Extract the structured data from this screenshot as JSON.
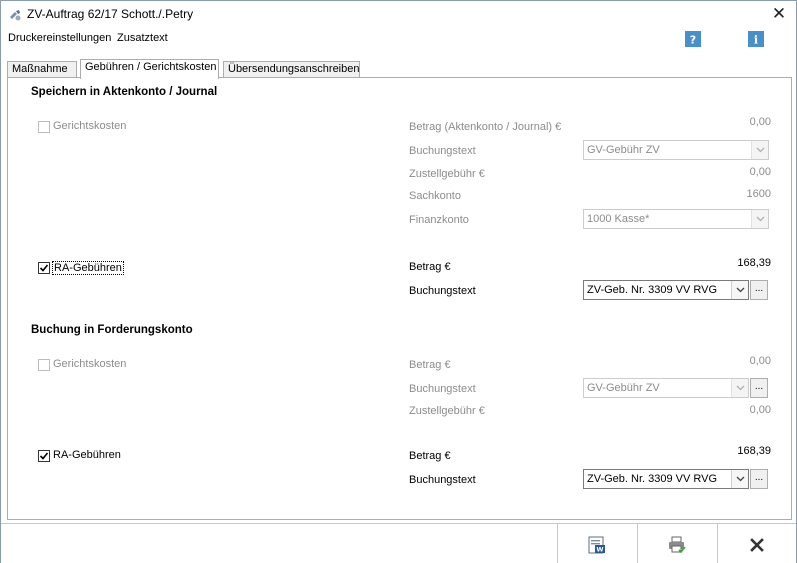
{
  "window": {
    "title": "ZV-Auftrag  62/17 Schott./.Petry",
    "close_icon": "close-icon"
  },
  "menu": {
    "items": [
      "Druckereinstellungen",
      "Zusatztext"
    ],
    "help_icon": "help-icon",
    "info_icon": "info-icon"
  },
  "tabs": [
    {
      "label": "Maßnahme",
      "active": false
    },
    {
      "label": "Gebühren / Gerichtskosten",
      "active": true
    },
    {
      "label": "Übersendungsanschreiben",
      "active": false
    }
  ],
  "section1": {
    "title": "Speichern in Aktenkonto / Journal",
    "gerichtskosten": {
      "label": "Gerichtskosten",
      "checked": false,
      "disabled": true,
      "betrag_label": "Betrag (Aktenkonto / Journal) €",
      "betrag_value": "0,00",
      "buchungstext_label": "Buchungstext",
      "buchungstext_value": "GV-Gebühr ZV",
      "zustell_label": "Zustellgebühr €",
      "zustell_value": "0,00",
      "sachkonto_label": "Sachkonto",
      "sachkonto_value": "1600",
      "finanzkonto_label": "Finanzkonto",
      "finanzkonto_value": "1000 Kasse*"
    },
    "ra_gebuehren": {
      "label": "RA-Gebühren",
      "checked": true,
      "betrag_label": "Betrag €",
      "betrag_value": "168,39",
      "buchungstext_label": "Buchungstext",
      "buchungstext_value": "ZV-Geb. Nr. 3309 VV RVG",
      "ellipsis": "..."
    }
  },
  "section2": {
    "title": "Buchung in Forderungskonto",
    "gerichtskosten": {
      "label": "Gerichtskosten",
      "checked": false,
      "disabled": true,
      "betrag_label": "Betrag €",
      "betrag_value": "0,00",
      "buchungstext_label": "Buchungstext",
      "buchungstext_value": "GV-Gebühr ZV",
      "ellipsis": "...",
      "zustell_label": "Zustellgebühr €",
      "zustell_value": "0,00"
    },
    "ra_gebuehren": {
      "label": "RA-Gebühren",
      "checked": true,
      "betrag_label": "Betrag €",
      "betrag_value": "168,39",
      "buchungstext_label": "Buchungstext",
      "buchungstext_value": "ZV-Geb. Nr. 3309 VV RVG",
      "ellipsis": "..."
    }
  },
  "footer": {
    "buttons": [
      "word-document-icon",
      "print-icon",
      "cancel-icon"
    ]
  },
  "colors": {
    "accent_blue": "#4a90c8",
    "disabled_text": "#8c8c8c",
    "border": "#adadad"
  }
}
